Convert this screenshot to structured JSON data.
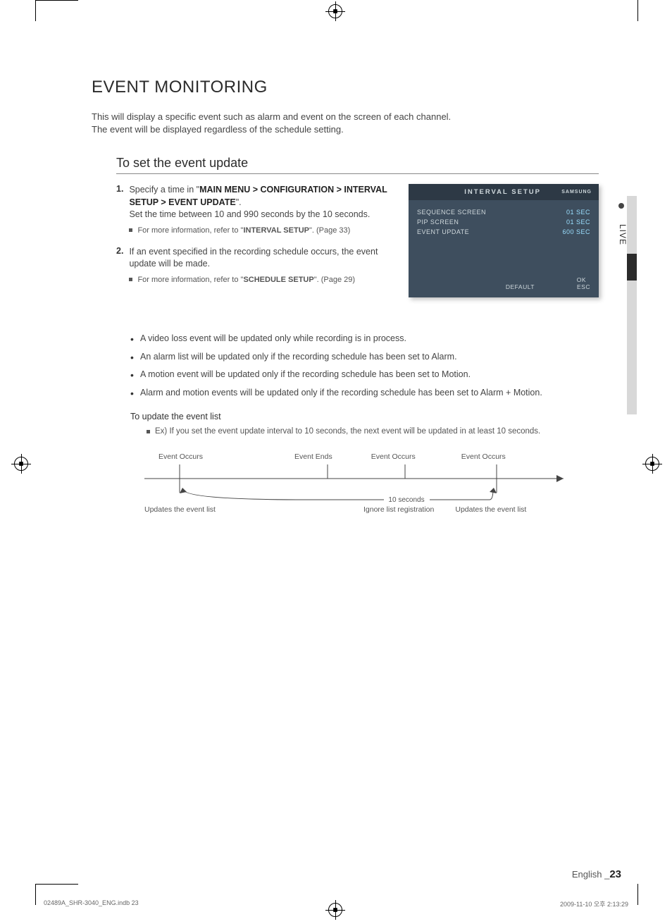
{
  "section_title": "EVENT MONITORING",
  "intro": {
    "p1": "This will display a specific event such as alarm and event on the screen of each channel.",
    "p2": "The event will be displayed regardless of the schedule setting."
  },
  "subhead": "To set the event update",
  "steps": {
    "s1": {
      "num": "1.",
      "lead": "Specify a time in \"",
      "path": "MAIN MENU > CONFIGURATION > INTERVAL SETUP > EVENT UPDATE",
      "tail": "\".",
      "sub": "Set the time between 10 and 990 seconds by the 10 seconds.",
      "note_lead": "For more information, refer to \"",
      "note_ref": "INTERVAL SETUP",
      "note_tail": "\". (Page 33)"
    },
    "s2": {
      "num": "2.",
      "lead": "If an event specified in the recording schedule occurs, the event update will be made.",
      "note_lead": "For more information, refer to \"",
      "note_ref": "SCHEDULE SETUP",
      "note_tail": "\". (Page 29)"
    }
  },
  "osd": {
    "title": "INTERVAL SETUP",
    "logo": "SAMSUNG",
    "rows": [
      {
        "label": "SEQUENCE SCREEN",
        "value": "01 SEC"
      },
      {
        "label": "PIP SCREEN",
        "value": "01 SEC"
      },
      {
        "label": "EVENT UPDATE",
        "value": "600 SEC"
      }
    ],
    "ok": "OK",
    "default": "DEFAULT",
    "esc": "ESC"
  },
  "sidetab": "LIVE",
  "bullets": {
    "b1": "A video loss event will be updated only while recording is in process.",
    "b2": "An alarm list will be updated only if the recording schedule has been set to Alarm.",
    "b3": "A motion event will be updated only if the recording schedule has been set to Motion.",
    "b4": "Alarm and motion events will be updated only if the recording schedule has been set to Alarm + Motion."
  },
  "subtitle2": "To update the event list",
  "example": "Ex) If you set the event update interval to 10 seconds, the next event will be updated in at least 10 seconds.",
  "timeline": {
    "top": {
      "t1": "Event Occurs",
      "t2": "Event Ends",
      "t3": "Event Occurs",
      "t4": "Event Occurs"
    },
    "mid": "10 seconds",
    "bottom": {
      "b1": "Updates the event list",
      "b2": "Ignore list registration",
      "b3": "Updates the event list"
    }
  },
  "footer_page_lang": "English _",
  "footer_page_num": "23",
  "print_footer_left": "02489A_SHR-3040_ENG.indb   23",
  "print_footer_right": "2009-11-10   오후 2:13:29"
}
